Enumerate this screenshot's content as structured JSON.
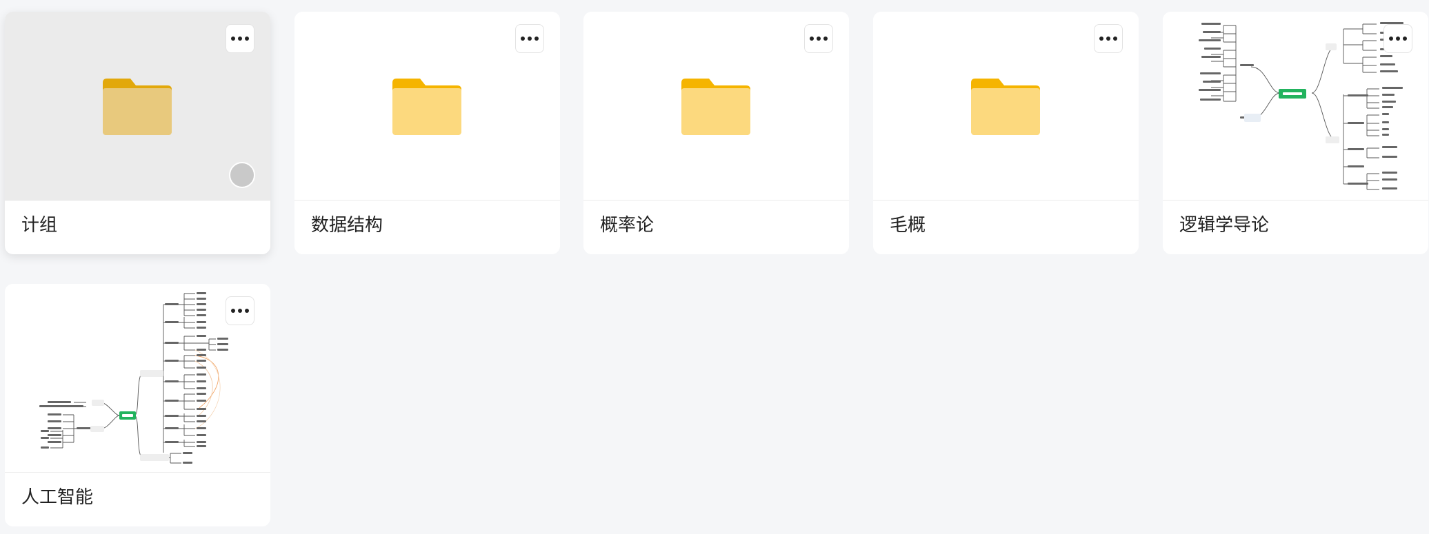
{
  "cards": [
    {
      "title": "计组",
      "kind": "folder",
      "icon": "folder-icon"
    },
    {
      "title": "数据结构",
      "kind": "folder",
      "icon": "folder-icon"
    },
    {
      "title": "概率论",
      "kind": "folder",
      "icon": "folder-icon"
    },
    {
      "title": "毛概",
      "kind": "folder",
      "icon": "folder-icon"
    },
    {
      "title": "逻辑学导论",
      "kind": "mindmap",
      "root": "逻辑学导论"
    },
    {
      "title": "人工智能",
      "kind": "mindmap",
      "root": "人工智能"
    }
  ],
  "colors": {
    "folder_tab": "#f5b400",
    "folder_body": "#fcd97e",
    "mindmap_root": "#22b35e",
    "page_bg": "#f5f6f8"
  }
}
